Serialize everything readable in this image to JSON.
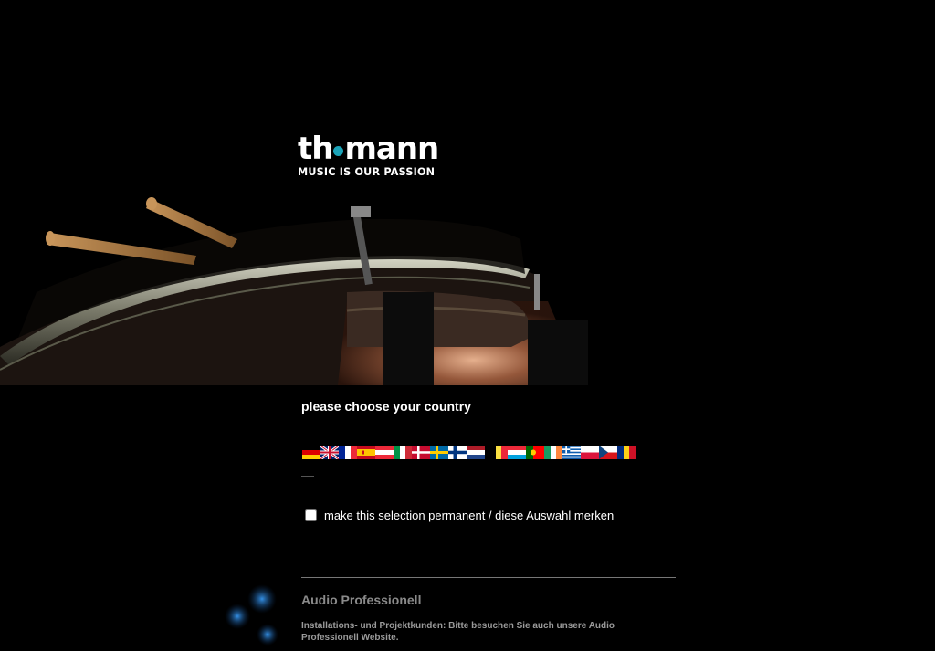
{
  "brand": {
    "wordmark_left": "th",
    "wordmark_right": "mann",
    "tagline": "MUSIC IS OUR PASSION",
    "accent_color": "#1ba3b8"
  },
  "country_select": {
    "heading": "please choose your country",
    "flags": [
      {
        "country": "de",
        "icon": "germany-flag-icon"
      },
      {
        "country": "gb",
        "icon": "uk-flag-icon"
      },
      {
        "country": "fr",
        "icon": "france-flag-icon"
      },
      {
        "country": "es",
        "icon": "spain-flag-icon"
      },
      {
        "country": "at",
        "icon": "austria-flag-icon"
      },
      {
        "country": "it",
        "icon": "italy-flag-icon"
      },
      {
        "country": "dk",
        "icon": "denmark-flag-icon"
      },
      {
        "country": "se",
        "icon": "sweden-flag-icon"
      },
      {
        "country": "fi",
        "icon": "finland-flag-icon"
      },
      {
        "country": "nl",
        "icon": "netherlands-flag-icon"
      },
      {
        "country": "be",
        "icon": "belgium-flag-icon"
      },
      {
        "country": "lu",
        "icon": "luxembourg-flag-icon"
      },
      {
        "country": "pt",
        "icon": "portugal-flag-icon"
      },
      {
        "country": "ie",
        "icon": "ireland-flag-icon"
      },
      {
        "country": "gr",
        "icon": "greece-flag-icon"
      },
      {
        "country": "pl",
        "icon": "poland-flag-icon"
      },
      {
        "country": "cz",
        "icon": "czech-flag-icon"
      },
      {
        "country": "ro",
        "icon": "romania-flag-icon"
      }
    ],
    "permanent_label": "make this selection permanent / diese Auswahl merken",
    "permanent_checked": false
  },
  "audio_pro": {
    "title": "Audio Professionell",
    "text": "Installations- und Projektkunden: Bitte besuchen Sie auch unsere Audio Professionell Website."
  }
}
